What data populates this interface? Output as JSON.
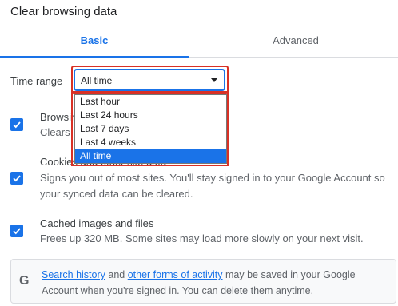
{
  "dialog": {
    "title": "Clear browsing data"
  },
  "tabs": [
    {
      "label": "Basic",
      "active": true
    },
    {
      "label": "Advanced",
      "active": false
    }
  ],
  "time_range": {
    "label": "Time range",
    "selected": "All time",
    "options": [
      "Last hour",
      "Last 24 hours",
      "Last 7 days",
      "Last 4 weeks",
      "All time"
    ]
  },
  "rows": [
    {
      "title": "Browsing history",
      "subtitle": "Clears history",
      "checked": true
    },
    {
      "title": "Cookies and other site data",
      "subtitle": "Signs you out of most sites. You'll stay signed in to your Google Account so",
      "subtitle2": "your synced data can be cleared.",
      "checked": true
    },
    {
      "title": "Cached images and files",
      "subtitle": "Frees up 320 MB. Some sites may load more slowly on your next visit.",
      "checked": true
    }
  ],
  "info": {
    "icon": "G",
    "link1": "Search history",
    "text1": " and ",
    "link2": "other forms of activity",
    "text2": " may be saved in your Google",
    "line2": "Account when you're signed in. You can delete them anytime."
  },
  "colors": {
    "accent": "#1a73e8",
    "highlight_outline": "#d93025"
  }
}
